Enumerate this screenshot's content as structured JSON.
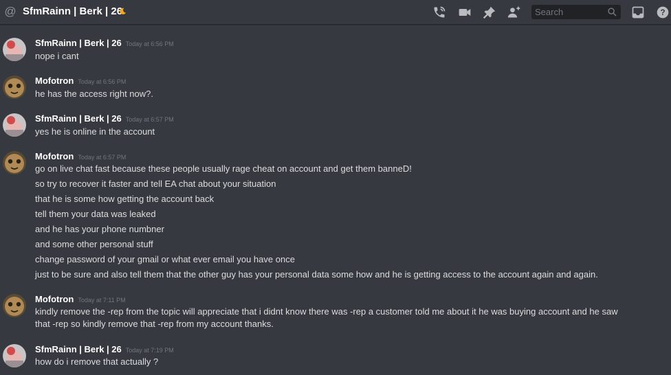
{
  "header": {
    "channel_title": "SfmRainn | Berk | 26",
    "search_placeholder": "Search"
  },
  "icons": [
    "at-icon",
    "moon-icon",
    "call-icon",
    "video-icon",
    "pin-icon",
    "add-friend-icon",
    "search-icon",
    "inbox-icon",
    "help-icon"
  ],
  "colors": {
    "background": "#36393f",
    "search_bg": "#202225",
    "username": "#ffffff",
    "timestamp": "#72767d",
    "text": "#dcddde",
    "moon": "#faa61a"
  },
  "messages": [
    {
      "author": "SfmRainn | Berk | 26",
      "timestamp": "Today at 6:56 PM",
      "lines": [
        "nope i cant"
      ]
    },
    {
      "author": "Mofotron",
      "timestamp": "Today at 6:56 PM",
      "lines": [
        "he has the access right now?."
      ]
    },
    {
      "author": "SfmRainn | Berk | 26",
      "timestamp": "Today at 6:57 PM",
      "lines": [
        "yes he is online in the account"
      ]
    },
    {
      "author": "Mofotron",
      "timestamp": "Today at 6:57 PM",
      "lines": [
        "go on live chat fast because these people usually rage cheat on account and get them banneD!",
        "so try to recover it faster and tell EA chat about your situation",
        "that he is some how getting the account back",
        "tell them your data was leaked",
        "and he has your phone numbner",
        "and some other personal stuff",
        "change password of your gmail or what ever email you have once",
        "just to be sure and also tell them that the other guy has  your personal data some how and he is getting access to the account again and again."
      ]
    },
    {
      "author": "Mofotron",
      "timestamp": "Today at 7:11 PM",
      "lines": [
        "kindly remove the -rep from the topic will appreciate that i didnt know there was -rep a customer told me about it he was buying account and he saw that -rep so kindly remove that -rep from my account thanks."
      ]
    },
    {
      "author": "SfmRainn | Berk | 26",
      "timestamp": "Today at 7:19 PM",
      "lines": [
        "how do i remove that actually ?"
      ]
    }
  ]
}
